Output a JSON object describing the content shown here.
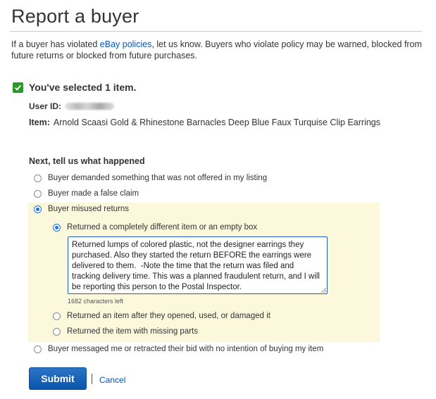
{
  "page": {
    "title": "Report a buyer",
    "intro_before": "If a buyer has violated ",
    "intro_link": "eBay policies",
    "intro_after": ", let us know. Buyers who violate policy may be warned, blocked from future returns or blocked from future purchases."
  },
  "selection": {
    "heading": "You've selected 1 item.",
    "user_id_label": "User ID:",
    "item_label": "Item:",
    "item_title": "Arnold Scaasi Gold & Rhinestone Barnacles Deep Blue Faux Turquise Clip Earrings"
  },
  "question": {
    "heading": "Next, tell us what happened",
    "options": [
      {
        "label": "Buyer demanded something that was not offered in my listing",
        "checked": false
      },
      {
        "label": "Buyer made a false claim",
        "checked": false
      },
      {
        "label": "Buyer misused returns",
        "checked": true
      },
      {
        "label": "Buyer messaged me or retracted their bid with no intention of buying my item",
        "checked": false
      }
    ],
    "sub_options": [
      {
        "label": "Returned a completely different item or an empty box",
        "checked": true
      },
      {
        "label": "Returned an item after they opened, used, or damaged it",
        "checked": false
      },
      {
        "label": "Returned the item with missing parts",
        "checked": false
      }
    ],
    "description": "Returned lumps of colored plastic, not the designer earrings they purchased. Also they started the return BEFORE the earrings were delivered to them.  -Note the time that the return was filed and tracking delivery time. This was a planned fraudulent return, and I will be reporting this person to the Postal Inspector.",
    "chars_left": "1682 characters left"
  },
  "actions": {
    "submit_label": "Submit",
    "cancel_label": "Cancel"
  },
  "colors": {
    "accent": "#0654ba",
    "check": "#2b9a2b",
    "highlight": "#fbf8dc"
  },
  "icons": {
    "selected": "checkmark-icon"
  }
}
